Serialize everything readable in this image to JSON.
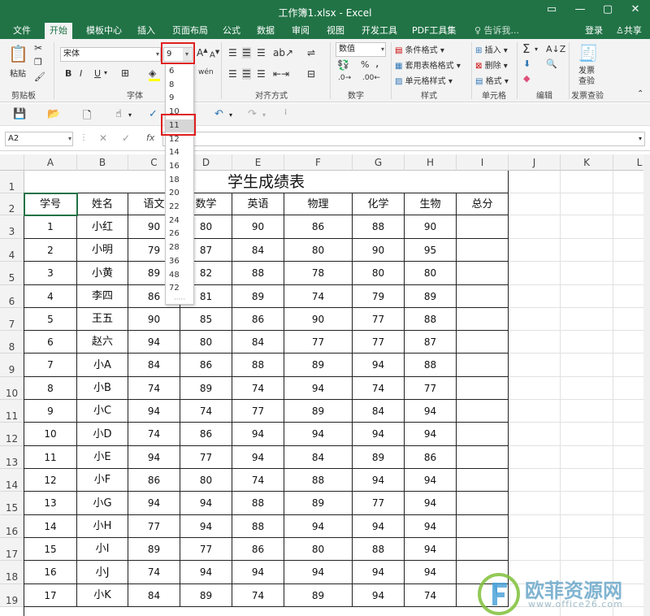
{
  "window": {
    "title": "工作簿1.xlsx - Excel",
    "buttons": [
      "▭",
      "—",
      "▢",
      "✕"
    ]
  },
  "tabs": [
    "文件",
    "开始",
    "模板中心",
    "插入",
    "页面布局",
    "公式",
    "数据",
    "审阅",
    "视图",
    "开发工具",
    "PDF工具集"
  ],
  "tellme": "♀ 告诉我...",
  "signin": "登录",
  "share": "共享",
  "ribbon": {
    "clipboard": {
      "paste": "粘贴",
      "label": "剪贴板"
    },
    "font": {
      "name": "宋体",
      "size": "9",
      "label": "字体",
      "bold": "B",
      "italic": "I",
      "underline": "U",
      "wen": "wén"
    },
    "alignment": {
      "label": "对齐方式"
    },
    "number": {
      "format": "数值",
      "label": "数字",
      "percent": "%",
      "comma": ","
    },
    "styles": {
      "conditional": "条件格式",
      "table": "套用表格格式",
      "cell": "单元格样式",
      "label": "样式"
    },
    "cells": {
      "insert": "插入",
      "delete": "删除",
      "format": "格式",
      "label": "单元格"
    },
    "editing": {
      "label": "编辑",
      "sigma": "Σ"
    },
    "audit": {
      "name1": "发票",
      "name2": "查验",
      "label": "发票查验"
    }
  },
  "formula_bar": {
    "name_box": "A2",
    "fx": "fx"
  },
  "font_sizes": [
    "6",
    "8",
    "9",
    "10",
    "11",
    "12",
    "14",
    "16",
    "18",
    "20",
    "22",
    "24",
    "26",
    "28",
    "36",
    "48",
    "72"
  ],
  "selected_font_size": "11",
  "columns": [
    "A",
    "B",
    "C",
    "D",
    "E",
    "F",
    "G",
    "H",
    "I",
    "J",
    "K",
    "L"
  ],
  "rows": [
    "1",
    "2",
    "3",
    "4",
    "5",
    "6",
    "7",
    "8",
    "9",
    "10",
    "11",
    "12",
    "13",
    "14",
    "15",
    "16",
    "17",
    "18",
    "19"
  ],
  "sheet_title": "学生成绩表",
  "headers": [
    "学号",
    "姓名",
    "语文",
    "数学",
    "英语",
    "物理",
    "化学",
    "生物",
    "总分"
  ],
  "records": [
    [
      "1",
      "小红",
      "90",
      "80",
      "90",
      "86",
      "88",
      "90"
    ],
    [
      "2",
      "小明",
      "79",
      "87",
      "84",
      "80",
      "90",
      "95"
    ],
    [
      "3",
      "小黄",
      "89",
      "82",
      "88",
      "78",
      "80",
      "80"
    ],
    [
      "4",
      "李四",
      "86",
      "81",
      "89",
      "74",
      "79",
      "89"
    ],
    [
      "5",
      "王五",
      "90",
      "85",
      "86",
      "90",
      "77",
      "88"
    ],
    [
      "6",
      "赵六",
      "94",
      "80",
      "84",
      "77",
      "77",
      "87"
    ],
    [
      "7",
      "小A",
      "84",
      "86",
      "88",
      "89",
      "94",
      "88"
    ],
    [
      "8",
      "小B",
      "74",
      "89",
      "74",
      "94",
      "74",
      "77"
    ],
    [
      "9",
      "小C",
      "94",
      "74",
      "77",
      "89",
      "84",
      "94"
    ],
    [
      "10",
      "小D",
      "74",
      "86",
      "94",
      "94",
      "94",
      "94"
    ],
    [
      "11",
      "小E",
      "94",
      "77",
      "94",
      "84",
      "89",
      "86"
    ],
    [
      "12",
      "小F",
      "86",
      "80",
      "74",
      "88",
      "94",
      "94"
    ],
    [
      "13",
      "小G",
      "94",
      "94",
      "88",
      "89",
      "77",
      "94"
    ],
    [
      "14",
      "小H",
      "77",
      "94",
      "88",
      "94",
      "94",
      "94"
    ],
    [
      "15",
      "小I",
      "89",
      "77",
      "86",
      "80",
      "88",
      "94"
    ],
    [
      "16",
      "小J",
      "74",
      "94",
      "94",
      "94",
      "94",
      "94"
    ],
    [
      "17",
      "小K",
      "84",
      "89",
      "74",
      "89",
      "94",
      "74"
    ]
  ],
  "watermark": {
    "brand": "欧菲资源网",
    "url": "www.office26.com"
  },
  "colors": {
    "excel_green": "#217346",
    "highlight_red": "#e02020",
    "selected_item": "#d6d6d6"
  }
}
